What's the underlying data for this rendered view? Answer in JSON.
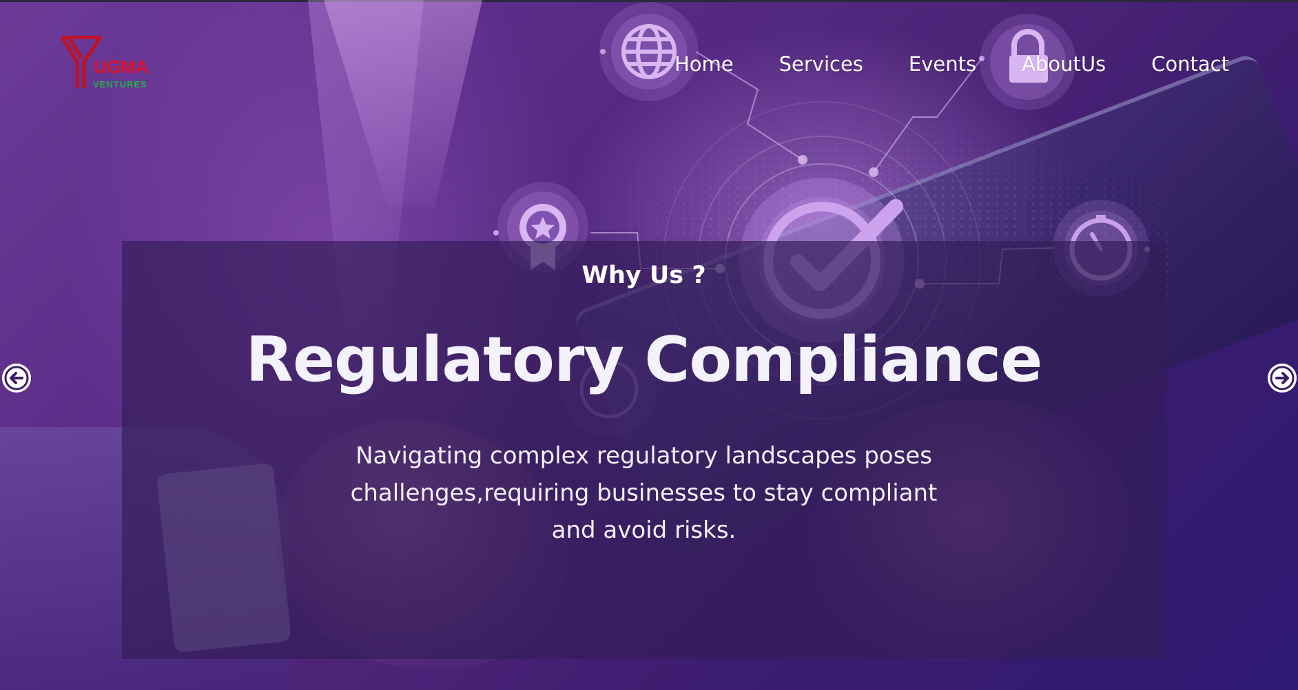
{
  "brand": {
    "logo_word": "UGMA",
    "logo_sub": "VENTURES"
  },
  "nav": {
    "items": [
      {
        "label": "Home"
      },
      {
        "label": "Services"
      },
      {
        "label": "Events"
      },
      {
        "label": "AboutUs"
      },
      {
        "label": "Contact"
      }
    ]
  },
  "hero": {
    "eyebrow": "Why Us ?",
    "title": "Regulatory Compliance",
    "description": "Navigating complex regulatory landscapes poses challenges,requiring businesses to stay compliant and avoid risks."
  },
  "carousel": {
    "prev_icon": "arrow-left-circle-icon",
    "next_icon": "arrow-right-circle-icon"
  },
  "decor_icons": [
    "globe-icon",
    "padlock-icon",
    "award-badge-icon",
    "checkmark-icon",
    "gauge-icon",
    "globe-small-icon"
  ],
  "colors": {
    "background_purple": "#4d2478",
    "panel_overlay": "#341e58",
    "logo_red": "#e0102a",
    "logo_green": "#22b14c",
    "text_white": "#ffffff"
  }
}
